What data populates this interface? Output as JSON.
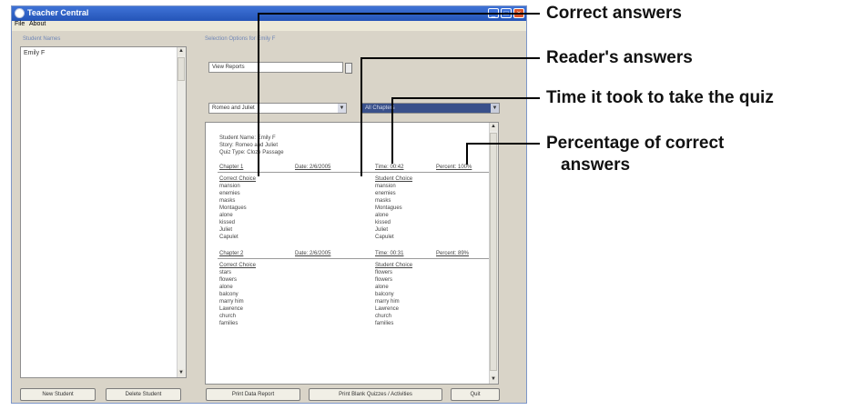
{
  "window": {
    "title": "Teacher Central",
    "controls": {
      "minimize": "_",
      "maximize": "□",
      "close": "×"
    }
  },
  "menu": [
    "File",
    "About"
  ],
  "left_panel": {
    "label": "Student Names",
    "students": [
      "Emily F"
    ]
  },
  "right_panel": {
    "label": "Selection Options for Emily F",
    "report_select": "View Reports",
    "story_select": "Romeo and Juliet",
    "chapter_select": "All Chapters"
  },
  "report": {
    "header": [
      "Student Name: Emily F",
      "Story: Romeo and Juliet",
      "Quiz Type: Cloze Passage"
    ],
    "chapters": [
      {
        "title": "Chapter 1",
        "date": "Date: 2/6/2005",
        "time": "Time: 00:42",
        "percent": "Percent: 100%",
        "correct_header": "Correct Choice",
        "student_header": "Student Choice",
        "correct": [
          "mansion",
          "enemies",
          "masks",
          "Montagues",
          "alone",
          "kissed",
          "Juliet",
          "Capulet"
        ],
        "student": [
          "mansion",
          "enemies",
          "masks",
          "Montagues",
          "alone",
          "kissed",
          "Juliet",
          "Capulet"
        ]
      },
      {
        "title": "Chapter 2",
        "date": "Date: 2/6/2005",
        "time": "Time: 00:31",
        "percent": "Percent: 89%",
        "correct_header": "Correct Choice",
        "student_header": "Student Choice",
        "correct": [
          "stars",
          "flowers",
          "alone",
          "balcony",
          "marry him",
          "Lawrence",
          "church",
          "families"
        ],
        "student": [
          "flowers",
          "flowers",
          "alone",
          "balcony",
          "marry him",
          "Lawrence",
          "church",
          "families"
        ]
      }
    ]
  },
  "buttons": {
    "new_student": "New Student",
    "delete_student": "Delete Student",
    "print_data": "Print Data Report",
    "print_blank": "Print Blank Quizzes / Activities",
    "quit": "Quit"
  },
  "annotations": [
    "Correct answers",
    "Reader's answers",
    "Time it took to take the quiz",
    "Percentage of correct",
    "answers"
  ]
}
